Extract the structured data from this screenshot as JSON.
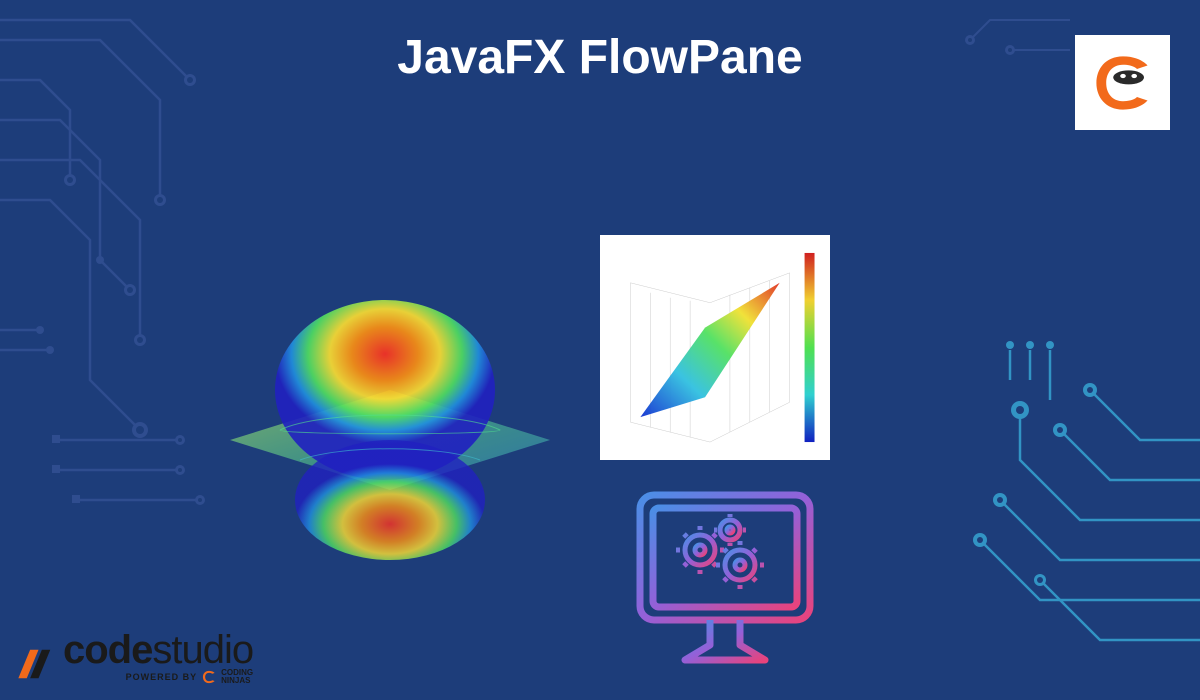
{
  "title": "JavaFX FlowPane",
  "logo": {
    "brand": "Coding Ninjas",
    "icon": "ninja-c-icon"
  },
  "footer": {
    "brand_bold": "code",
    "brand_light": "studio",
    "powered_by": "POWERED BY",
    "sub_brand_line1": "CODING",
    "sub_brand_line2": "NINJAS"
  },
  "graphics": {
    "surface": "3d-surface-plot-rainbow",
    "plot": "3d-diagonal-plane-plot",
    "computer": "computer-gears-gradient-icon",
    "circuits": "circuit-board-decoration"
  },
  "colors": {
    "bg": "#1d3d7a",
    "circuit_tl": "#3d5a99",
    "circuit_br": "#2b7fa8",
    "accent_orange": "#f26a1b",
    "gradient_start": "#4a8fe7",
    "gradient_end": "#e8437c"
  }
}
